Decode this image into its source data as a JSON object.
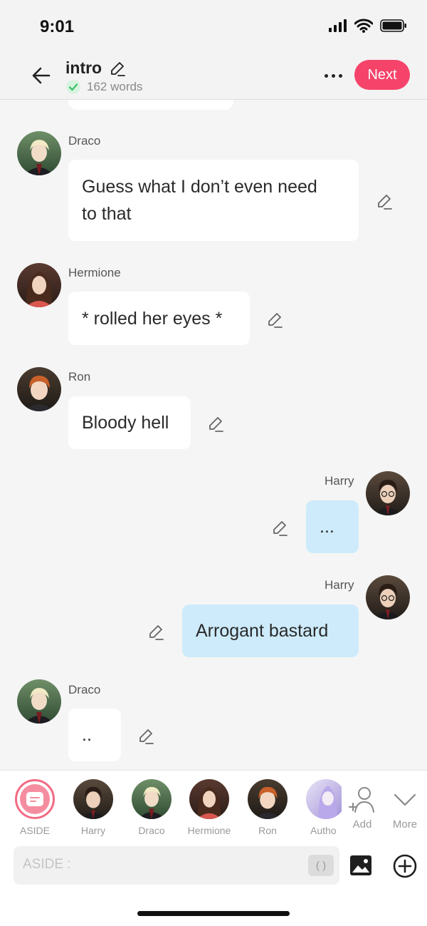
{
  "status_bar": {
    "time": "9:01"
  },
  "header": {
    "title": "intro",
    "word_count": "162 words",
    "next_label": "Next"
  },
  "messages": [
    {
      "speaker": "Draco",
      "text_lines": [
        "Guess what I don’t even need",
        "to that"
      ],
      "side": "left"
    },
    {
      "speaker": "Hermione",
      "text": "* rolled her eyes *",
      "side": "left"
    },
    {
      "speaker": "Ron",
      "text": "Bloody hell",
      "side": "left"
    },
    {
      "speaker": "Harry",
      "text": "...",
      "side": "right"
    },
    {
      "speaker": "Harry",
      "text": "Arrogant bastard",
      "side": "right"
    },
    {
      "speaker": "Draco",
      "text": "..",
      "side": "left"
    }
  ],
  "characters": [
    {
      "label": "ASIDE"
    },
    {
      "label": "Harry"
    },
    {
      "label": "Draco"
    },
    {
      "label": "Hermione"
    },
    {
      "label": "Ron"
    },
    {
      "label": "Autho"
    }
  ],
  "tools": {
    "add_label": "Add",
    "more_label": "More"
  },
  "input": {
    "prefix": "ASIDE :",
    "paren_label": "( )"
  },
  "colors": {
    "accent": "#f5436a",
    "right_bubble": "#cdebfb",
    "check_green": "#3cc46a"
  }
}
